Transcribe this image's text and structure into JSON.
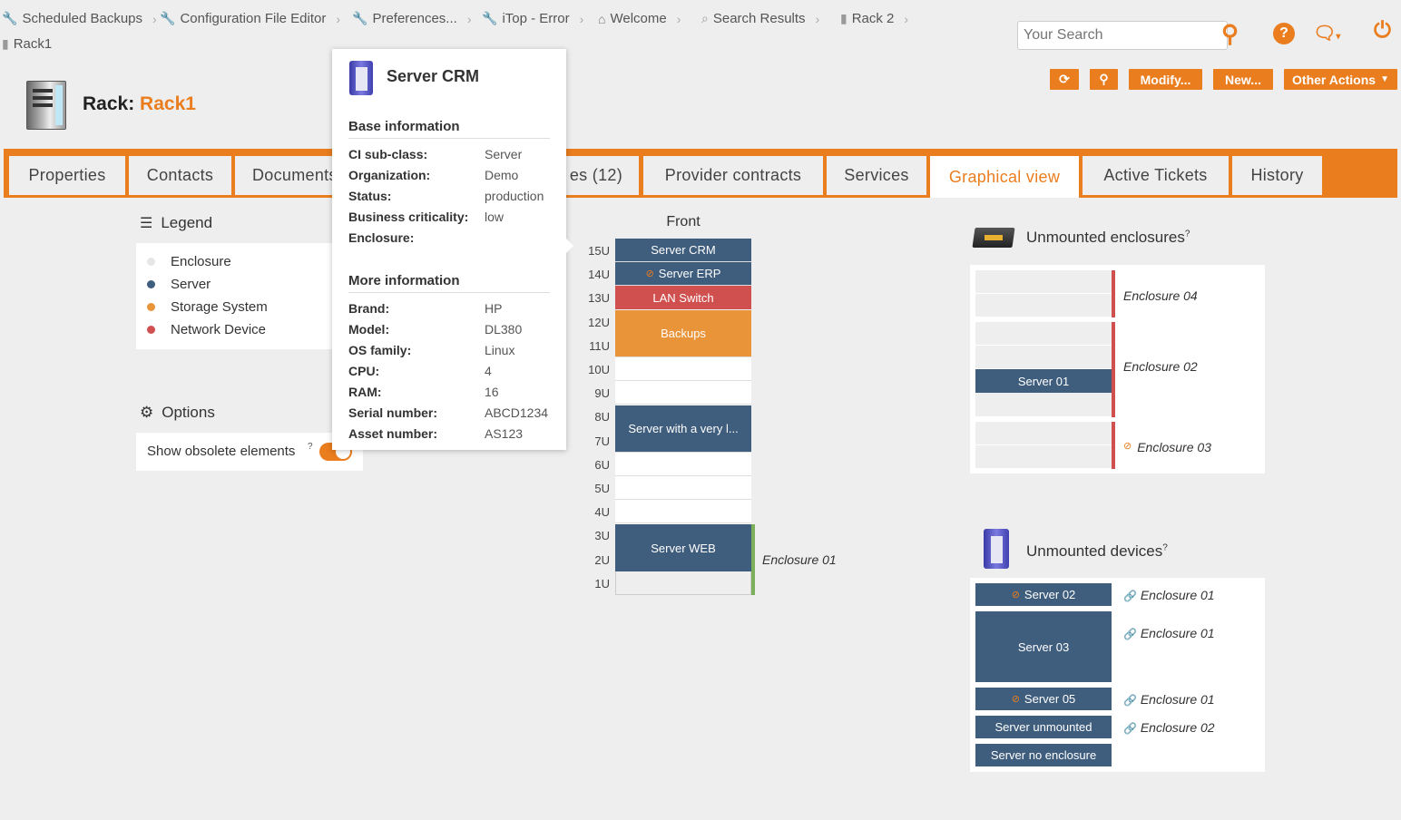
{
  "breadcrumb": [
    {
      "icon": "wrench-icon",
      "label": "Scheduled Backups"
    },
    {
      "icon": "wrench-icon",
      "label": "Configuration File Editor"
    },
    {
      "icon": "wrench-icon",
      "label": "Preferences..."
    },
    {
      "icon": "wrench-icon",
      "label": "iTop - Error"
    },
    {
      "icon": "home-icon",
      "label": "Welcome"
    },
    {
      "icon": "search-icon",
      "label": "Search Results"
    },
    {
      "icon": "rack-icon",
      "label": "Rack 2"
    },
    {
      "icon": "rack-icon",
      "label": "Rack1"
    }
  ],
  "search": {
    "placeholder": "Your Search"
  },
  "actions": {
    "refresh": "",
    "search": "",
    "modify": "Modify...",
    "new": "New...",
    "other": "Other Actions"
  },
  "title": {
    "prefix": "Rack:",
    "name": "Rack1"
  },
  "tabs": [
    {
      "label": "Properties"
    },
    {
      "label": "Contacts"
    },
    {
      "label": "Documents"
    },
    {
      "label": "es (12)"
    },
    {
      "label": "Provider contracts"
    },
    {
      "label": "Services"
    },
    {
      "label": "Graphical view",
      "active": true
    },
    {
      "label": "Active Tickets"
    },
    {
      "label": "History"
    }
  ],
  "legend": {
    "title": "Legend",
    "items": [
      {
        "label": "Enclosure",
        "color": "#eeeeee"
      },
      {
        "label": "Server",
        "color": "#3f5d7d"
      },
      {
        "label": "Storage System",
        "color": "#ea943a"
      },
      {
        "label": "Network Device",
        "color": "#d0504f"
      }
    ]
  },
  "options": {
    "title": "Options",
    "show_obsolete": "Show obsolete elements",
    "tooltip_mark": "?"
  },
  "rack": {
    "face": "Front",
    "units": [
      "15U",
      "14U",
      "13U",
      "12U",
      "11U",
      "10U",
      "9U",
      "8U",
      "7U",
      "6U",
      "5U",
      "4U",
      "3U",
      "2U",
      "1U"
    ],
    "devices": {
      "crm": "Server CRM",
      "erp": "Server ERP",
      "lan": "LAN Switch",
      "backups": "Backups",
      "long": "Server with a very l...",
      "web": "Server WEB"
    },
    "enclosure_label": "Enclosure 01"
  },
  "popup": {
    "title": "Server CRM",
    "base_title": "Base information",
    "base": [
      {
        "k": "CI sub-class:",
        "v": "Server"
      },
      {
        "k": "Organization:",
        "v": "Demo"
      },
      {
        "k": "Status:",
        "v": "production"
      },
      {
        "k": "Business criticality:",
        "v": "low"
      },
      {
        "k": "Enclosure:",
        "v": ""
      }
    ],
    "more_title": "More information",
    "more": [
      {
        "k": "Brand:",
        "v": "HP"
      },
      {
        "k": "Model:",
        "v": "DL380"
      },
      {
        "k": "OS family:",
        "v": "Linux"
      },
      {
        "k": "CPU:",
        "v": "4"
      },
      {
        "k": "RAM:",
        "v": "16"
      },
      {
        "k": "Serial number:",
        "v": "ABCD1234"
      },
      {
        "k": "Asset number:",
        "v": "AS123"
      }
    ]
  },
  "unmounted_enclosures": {
    "title": "Unmounted enclosures",
    "tooltip_mark": "?",
    "enc04": "Enclosure 04",
    "enc02": "Enclosure 02",
    "enc02_server": "Server 01",
    "enc03": "Enclosure 03"
  },
  "unmounted_devices": {
    "title": "Unmounted devices",
    "tooltip_mark": "?",
    "items": [
      {
        "label": "Server 02",
        "enclosure": "Enclosure 01"
      },
      {
        "label": "Server 03",
        "enclosure": "Enclosure 01"
      },
      {
        "label": "Server 05",
        "enclosure": "Enclosure 01"
      },
      {
        "label": "Server unmounted",
        "enclosure": "Enclosure 02"
      },
      {
        "label": "Server no enclosure",
        "enclosure": ""
      }
    ]
  }
}
